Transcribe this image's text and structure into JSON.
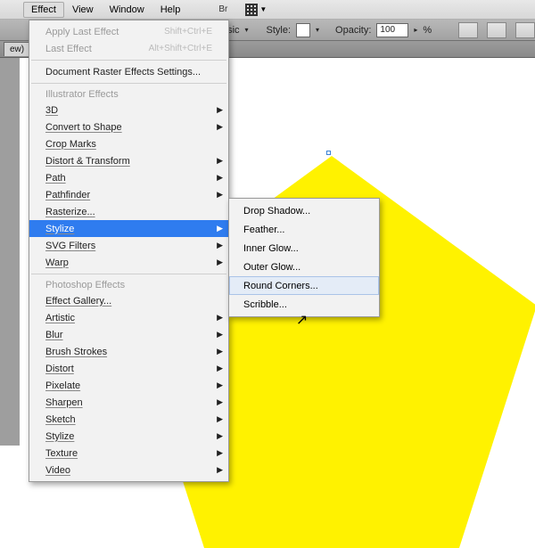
{
  "menubar": {
    "items": [
      "Effect",
      "View",
      "Window",
      "Help"
    ],
    "activeIndex": 0,
    "br_label": "Br"
  },
  "optbar": {
    "basic_label": "Basic",
    "style_label": "Style:",
    "opacity_label": "Opacity:",
    "opacity_value": "100",
    "percent": "%"
  },
  "docbar": {
    "tab": "ew)"
  },
  "effect_menu": {
    "apply": {
      "label": "Apply Last Effect",
      "shortcut": "Shift+Ctrl+E"
    },
    "last": {
      "label": "Last Effect",
      "shortcut": "Alt+Shift+Ctrl+E"
    },
    "raster": "Document Raster Effects Settings...",
    "hdr_ill": "Illustrator Effects",
    "ill": [
      {
        "label": "3D",
        "arrow": true
      },
      {
        "label": "Convert to Shape",
        "arrow": true
      },
      {
        "label": "Crop Marks",
        "arrow": false
      },
      {
        "label": "Distort & Transform",
        "arrow": true
      },
      {
        "label": "Path",
        "arrow": true
      },
      {
        "label": "Pathfinder",
        "arrow": true
      },
      {
        "label": "Rasterize...",
        "arrow": false
      },
      {
        "label": "Stylize",
        "arrow": true,
        "highlight": true
      },
      {
        "label": "SVG Filters",
        "arrow": true
      },
      {
        "label": "Warp",
        "arrow": true
      }
    ],
    "hdr_ps": "Photoshop Effects",
    "ps": [
      {
        "label": "Effect Gallery...",
        "arrow": false
      },
      {
        "label": "Artistic",
        "arrow": true
      },
      {
        "label": "Blur",
        "arrow": true
      },
      {
        "label": "Brush Strokes",
        "arrow": true
      },
      {
        "label": "Distort",
        "arrow": true
      },
      {
        "label": "Pixelate",
        "arrow": true
      },
      {
        "label": "Sharpen",
        "arrow": true
      },
      {
        "label": "Sketch",
        "arrow": true
      },
      {
        "label": "Stylize",
        "arrow": true
      },
      {
        "label": "Texture",
        "arrow": true
      },
      {
        "label": "Video",
        "arrow": true
      }
    ]
  },
  "stylize_submenu": {
    "items": [
      "Drop Shadow...",
      "Feather...",
      "Inner Glow...",
      "Outer Glow...",
      "Round Corners...",
      "Scribble..."
    ],
    "hoverIndex": 4
  },
  "shape": {
    "fill": "#fff200",
    "stroke": "none"
  }
}
